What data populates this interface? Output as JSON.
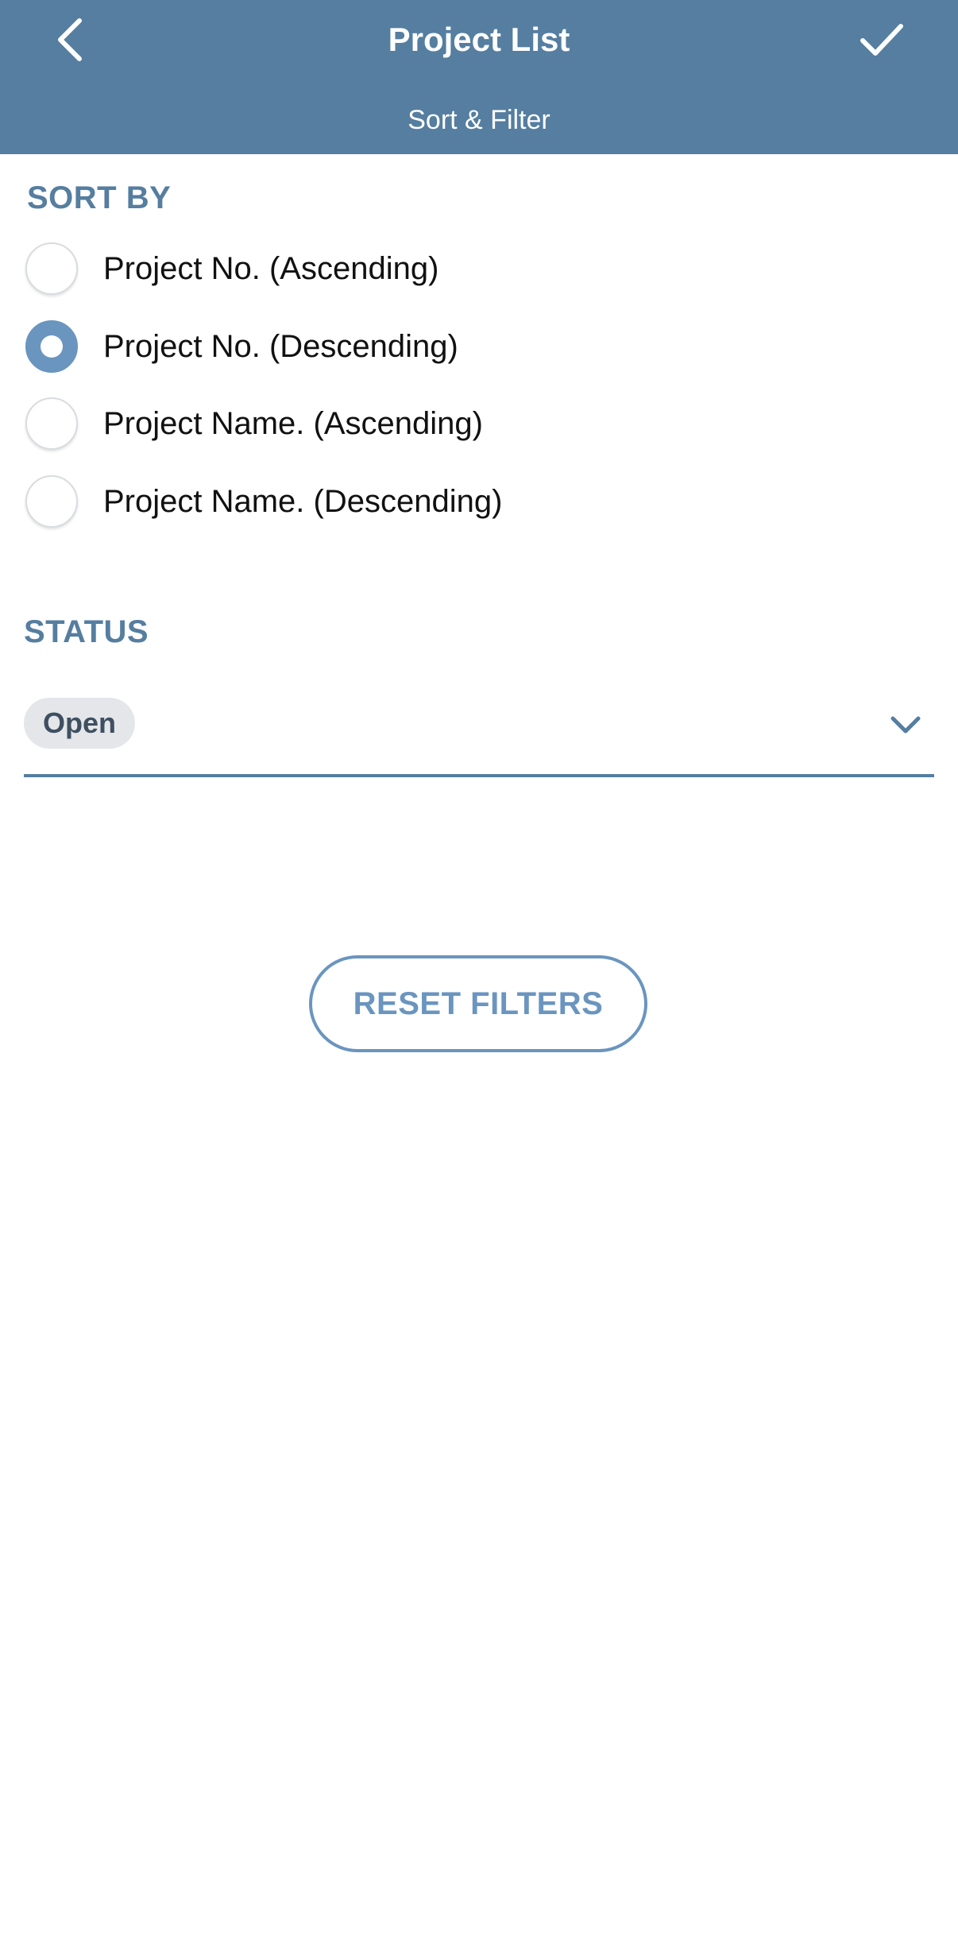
{
  "header": {
    "title": "Project List",
    "subtitle": "Sort & Filter",
    "back_icon": "chevron-left-icon",
    "confirm_icon": "checkmark-icon",
    "background_color": "#557ea0"
  },
  "sort": {
    "label": "SORT BY",
    "options": [
      {
        "label": "Project No. (Ascending)",
        "selected": false
      },
      {
        "label": "Project No. (Descending)",
        "selected": true
      },
      {
        "label": "Project Name. (Ascending)",
        "selected": false
      },
      {
        "label": "Project Name. (Descending)",
        "selected": false
      }
    ]
  },
  "status": {
    "label": "STATUS",
    "selected_chip": "Open",
    "dropdown_icon": "chevron-down-icon"
  },
  "reset": {
    "label": "RESET FILTERS"
  },
  "colors": {
    "accent": "#6a95bf",
    "section_label": "#557ea0"
  }
}
